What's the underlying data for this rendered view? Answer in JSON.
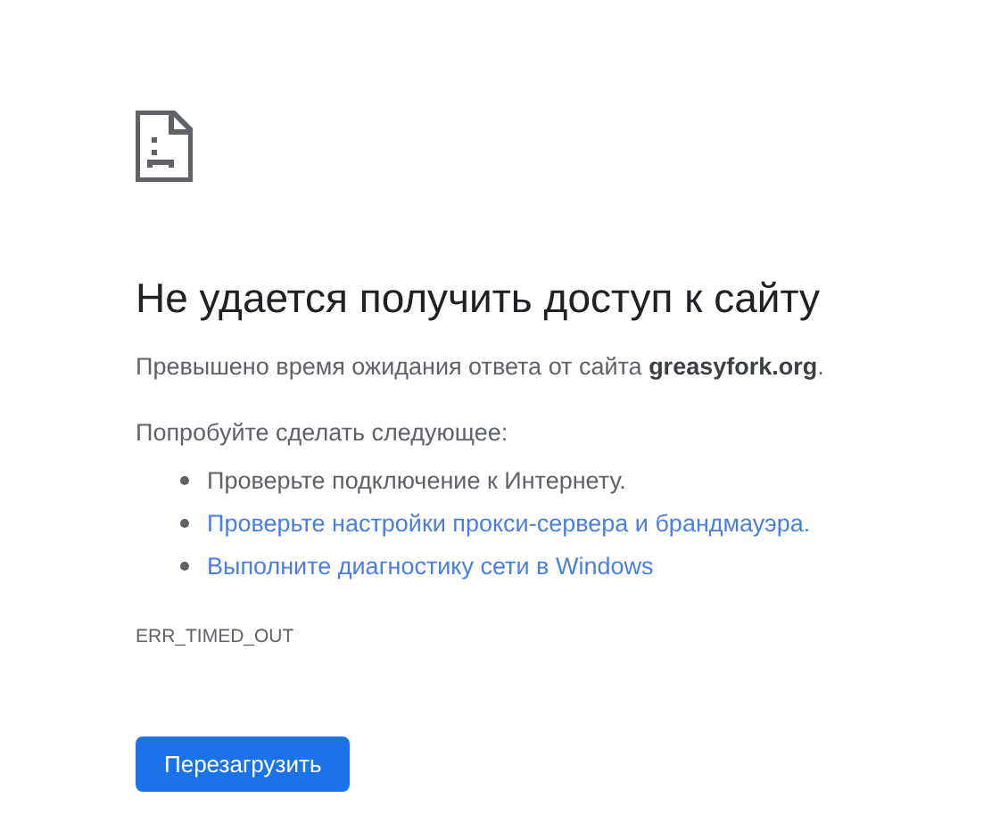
{
  "heading": "Не удается получить доступ к сайту",
  "description": "Превышено время ожидания ответа от сайта **greasyfork.org**.",
  "suggestions_intro": "Попробуйте сделать следующее:",
  "suggestions": [
    {
      "kind": "text",
      "text": "Проверьте подключение к Интернету."
    },
    {
      "kind": "link",
      "text": "Проверьте настройки прокси-сервера и брандмауэра."
    },
    {
      "kind": "link",
      "text": "Выполните диагностику сети в Windows"
    }
  ],
  "error_code": "ERR_TIMED_OUT",
  "button": "Перезагрузить"
}
